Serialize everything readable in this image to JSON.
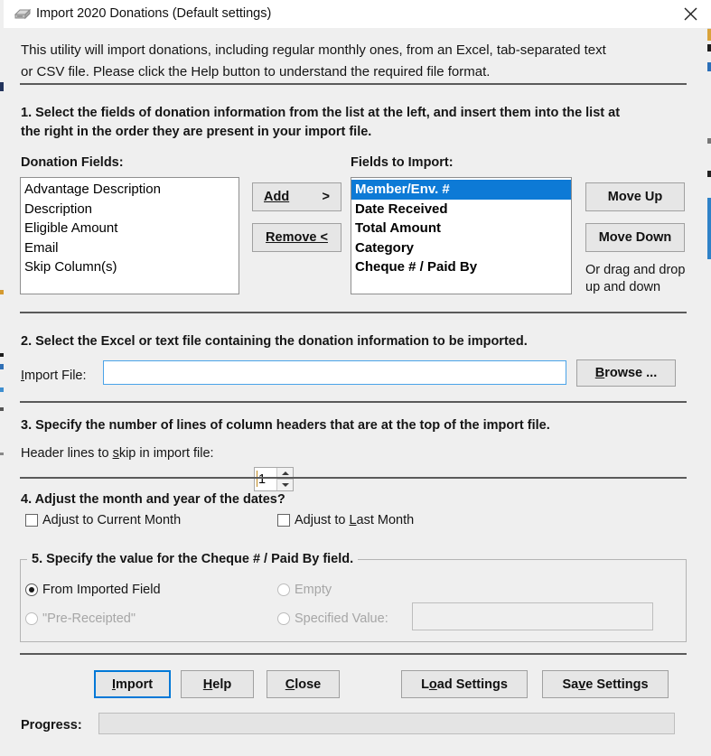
{
  "window": {
    "title": "Import 2020 Donations (Default settings)",
    "icon": "scanner-icon",
    "close_icon": "close-icon"
  },
  "intro": {
    "line1": "This utility will import donations, including regular monthly ones, from an Excel, tab-separated text",
    "line2": "or CSV file. Please click the Help button to understand the required file format."
  },
  "step1": {
    "instruction_line1": "1. Select the fields of donation information from the list at the left, and insert them into the list at",
    "instruction_line2": "the right in the order they are present in your import file.",
    "donation_fields_label": "Donation Fields:",
    "fields_to_import_label": "Fields to Import:",
    "donation_fields": [
      "Advantage Description",
      "Description",
      "Eligible Amount",
      "Email",
      "Skip Column(s)"
    ],
    "fields_to_import": [
      "Member/Env. #",
      "Date Received",
      "Total Amount",
      "Category",
      "Cheque # / Paid By"
    ],
    "selected_import_field_index": 0,
    "add_label": "Add",
    "add_arrow": ">",
    "remove_label": "Remove <",
    "move_up_label": "Move Up",
    "move_down_label": "Move Down",
    "drag_hint_line1": "Or drag and drop",
    "drag_hint_line2": "up and down"
  },
  "step2": {
    "instruction": "2. Select the Excel or text file containing the donation information to be imported.",
    "import_file_label": "Import File:",
    "import_file_value": "",
    "browse_label": "Browse ..."
  },
  "step3": {
    "instruction": "3. Specify the number of lines of column headers that are at the top of the import file.",
    "header_lines_label": "Header lines to skip in import file:",
    "header_lines_value": "1"
  },
  "step4": {
    "instruction": "4. Adjust the month and year of the dates?",
    "adjust_current_month_label": "Adjust to Current Month",
    "adjust_current_month_checked": false,
    "adjust_last_month_label": "Adjust to Last Month",
    "adjust_last_month_checked": false
  },
  "step5": {
    "title": "5. Specify the value for the Cheque # / Paid By field.",
    "options": [
      {
        "label": "From Imported Field",
        "checked": true,
        "disabled": false
      },
      {
        "label": "Empty",
        "checked": false,
        "disabled": true
      },
      {
        "label": "\"Pre-Receipted\"",
        "checked": false,
        "disabled": true
      },
      {
        "label": "Specified Value:",
        "checked": false,
        "disabled": true
      }
    ],
    "specified_value": ""
  },
  "buttons": {
    "import_label": "Import",
    "help_label": "Help",
    "close_label": "Close",
    "load_settings_label": "Load Settings",
    "save_settings_label": "Save Settings"
  },
  "progress": {
    "label": "Progress:",
    "percent": 0
  },
  "colors": {
    "selection_blue": "#0d7ad6",
    "focus_blue": "#0078d7",
    "dialog_face": "#efefef",
    "separator": "#5a5a5a"
  }
}
